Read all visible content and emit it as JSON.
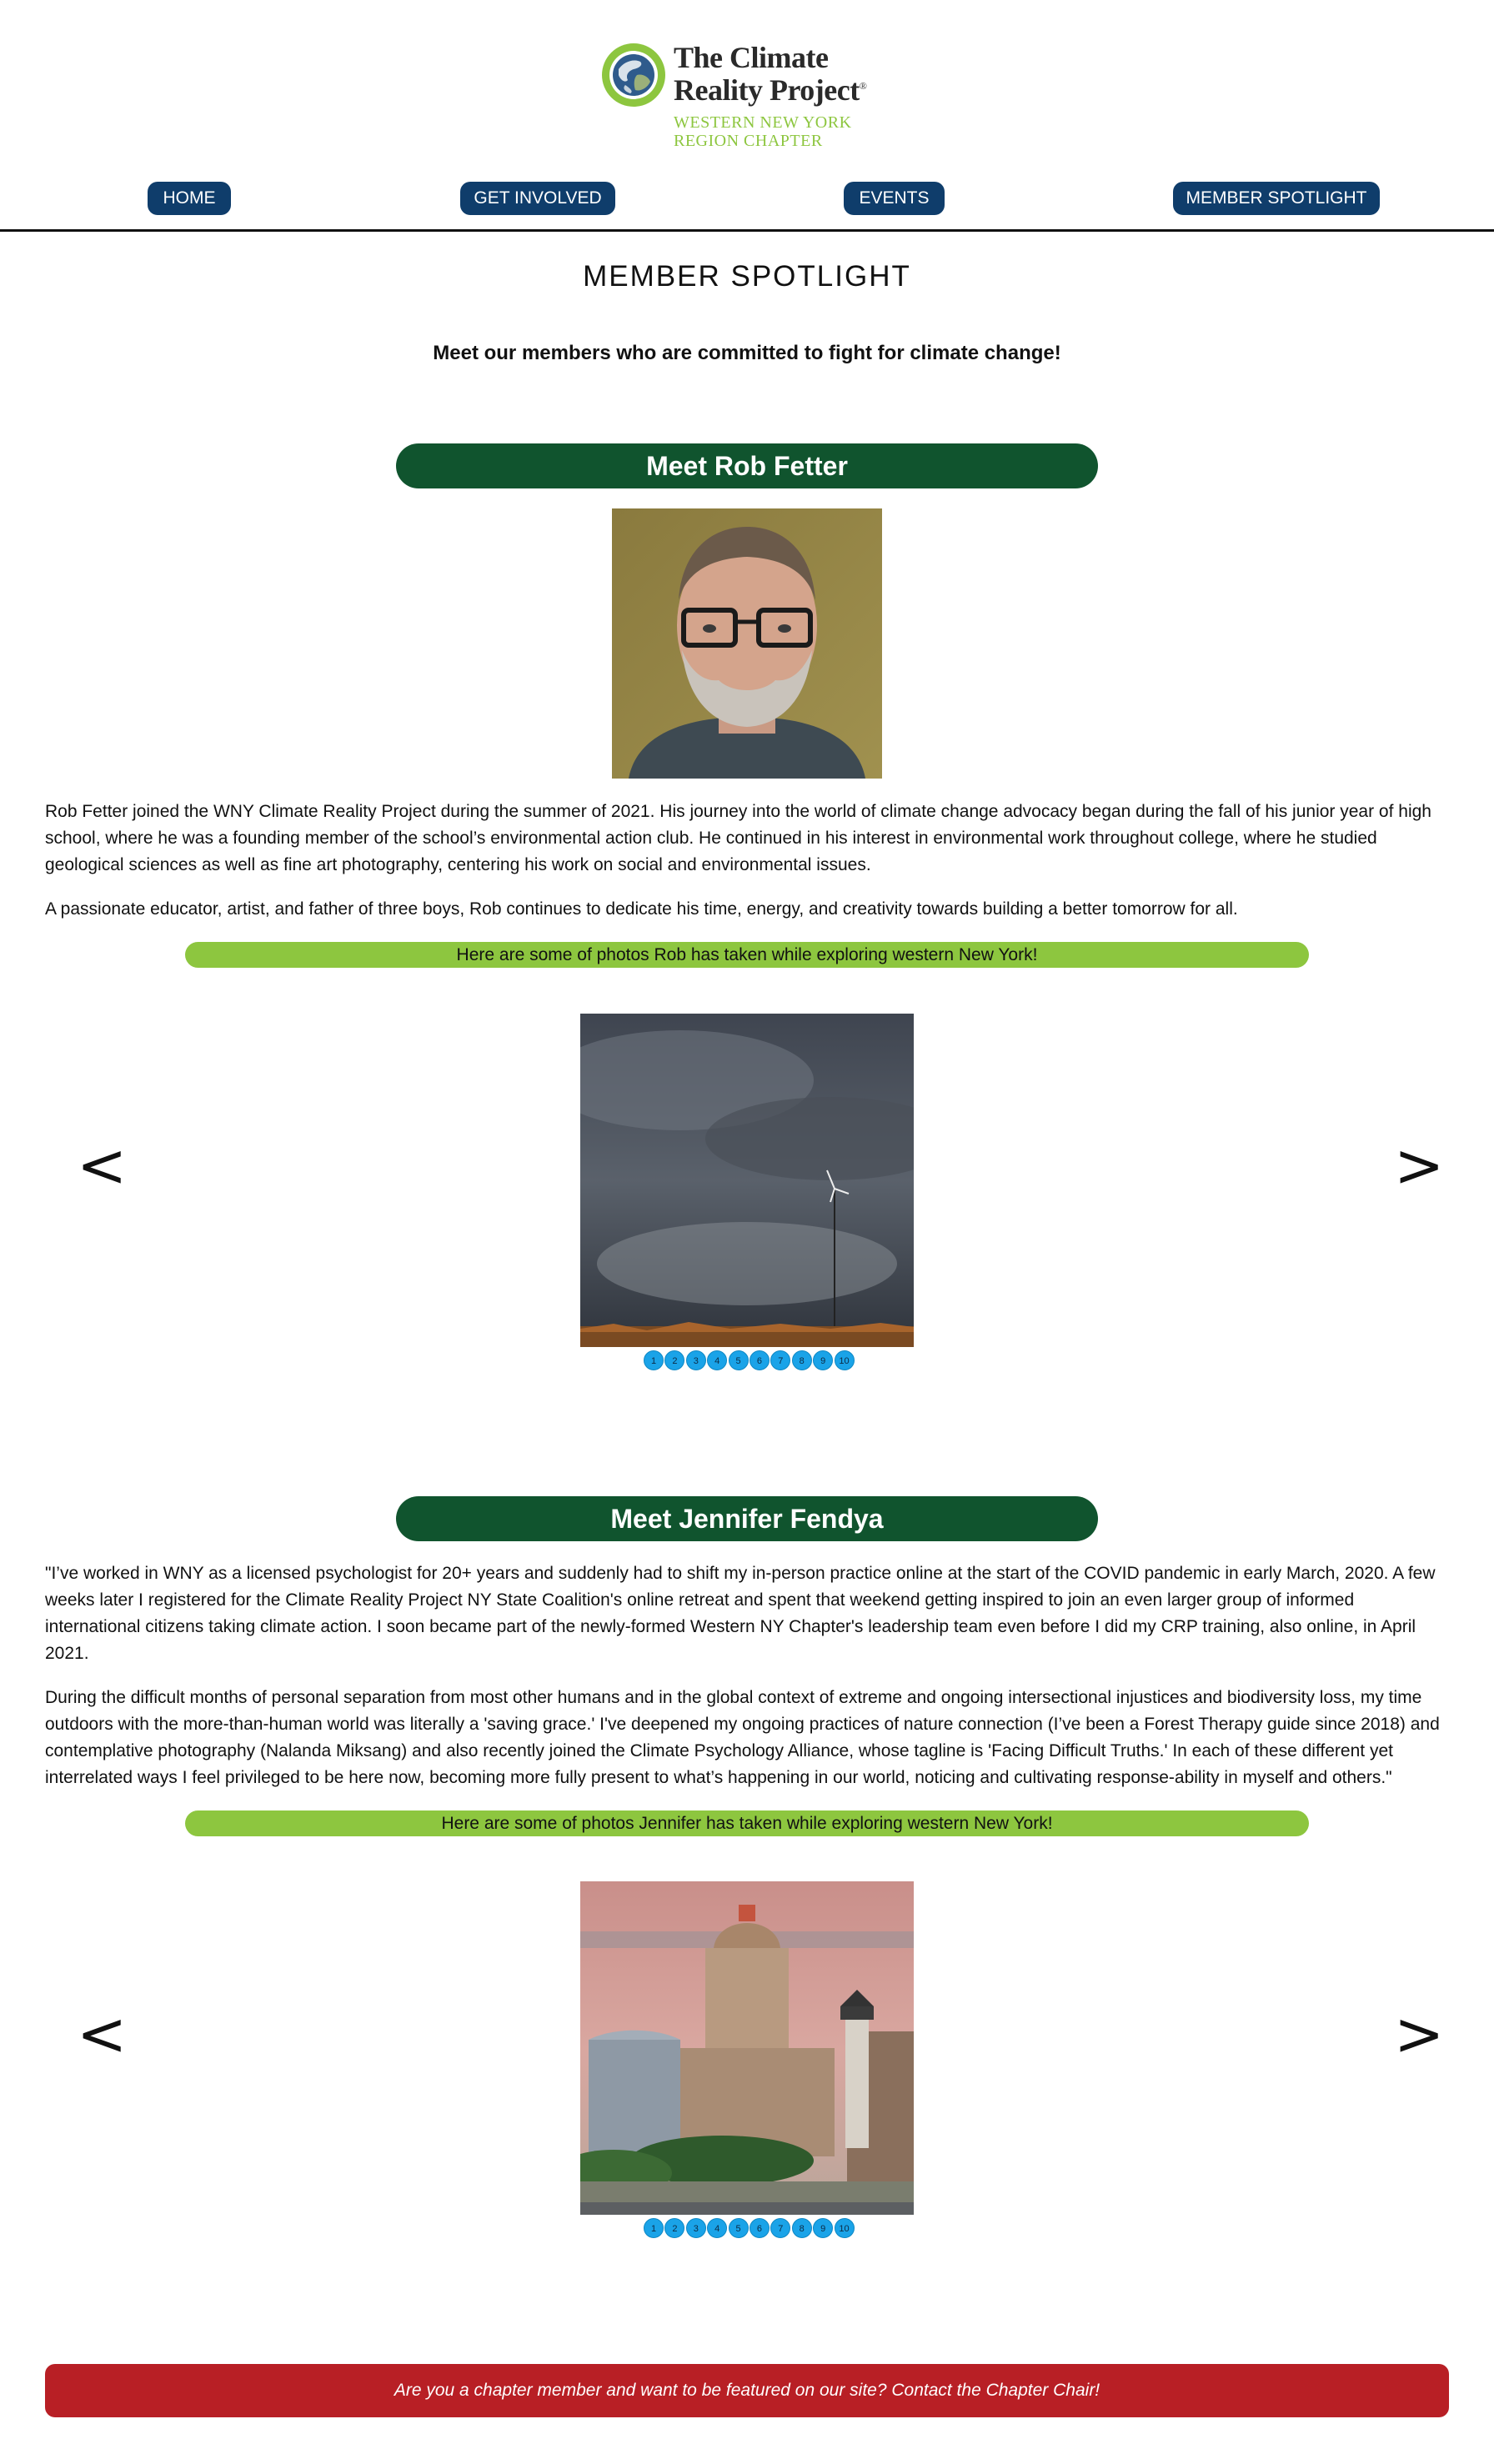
{
  "logo": {
    "title_line1": "The Climate",
    "title_line2": "Reality Project",
    "registered_mark": "®",
    "subtitle_line1": "WESTERN NEW YORK",
    "subtitle_line2": "REGION CHAPTER",
    "icon": "globe-icon"
  },
  "nav": {
    "items": [
      {
        "label": "HOME"
      },
      {
        "label": "GET INVOLVED"
      },
      {
        "label": "EVENTS"
      },
      {
        "label": "MEMBER SPOTLIGHT"
      }
    ]
  },
  "page": {
    "title": "MEMBER SPOTLIGHT",
    "intro": "Meet our members who are committed to fight for climate change!"
  },
  "members": [
    {
      "heading": "Meet Rob Fetter",
      "bio": [
        "Rob Fetter joined the WNY Climate Reality Project during the summer of 2021. His journey into the world of climate change advocacy began during the fall of his junior year of high school, where he was a founding member of the school’s environmental action club. He continued in his interest in environmental work throughout college, where he studied geological sciences as well as fine art photography, centering his work on social and environmental issues.",
        "A passionate educator, artist, and father of three boys, Rob continues to dedicate his time, energy, and creativity towards building a better tomorrow for all."
      ],
      "photos_banner": "Here are some of photos Rob has taken while exploring western New York!",
      "carousel": {
        "prev": "<",
        "next": ">",
        "current_slide": 1,
        "dots": [
          "1",
          "2",
          "3",
          "4",
          "5",
          "6",
          "7",
          "8",
          "9",
          "10"
        ]
      }
    },
    {
      "heading": "Meet Jennifer Fendya",
      "bio": [
        "\"I’ve worked in WNY as a licensed psychologist for 20+ years and suddenly had to shift my in-person practice online at the start of the COVID pandemic in early March, 2020. A few weeks later I registered for the Climate Reality Project NY State Coalition's online retreat and spent that weekend getting inspired to join an even larger group of informed international citizens taking climate action. I soon became part of the newly-formed Western NY Chapter's leadership team even before I did my CRP training, also online, in April 2021.",
        "During the difficult months of personal separation from most other humans and in the global context of extreme and ongoing intersectional injustices and biodiversity loss, my time outdoors with the more-than-human world was literally a 'saving grace.' I've deepened my ongoing practices of nature connection (I’ve been a Forest Therapy guide since 2018) and contemplative photography (Nalanda Miksang) and also recently joined the Climate Psychology Alliance, whose tagline is 'Facing Difficult Truths.' In each of these different yet interrelated ways I feel privileged to be here now, becoming more fully present to what’s happening in our world, noticing and cultivating response-ability in myself and others.\""
      ],
      "photos_banner": "Here are some of photos Jennifer has taken while exploring western New York!",
      "carousel": {
        "prev": "<",
        "next": ">",
        "current_slide": 1,
        "dots": [
          "1",
          "2",
          "3",
          "4",
          "5",
          "6",
          "7",
          "8",
          "9",
          "10"
        ]
      }
    }
  ],
  "contact_banner": "Are you a chapter member and want to be featured on our site? Contact the Chapter Chair!",
  "colors": {
    "nav": "#0f3d6b",
    "meet_banner": "#10542e",
    "photo_banner": "#8dc63f",
    "dot": "#1aa3e8",
    "contact": "#b81f25"
  }
}
